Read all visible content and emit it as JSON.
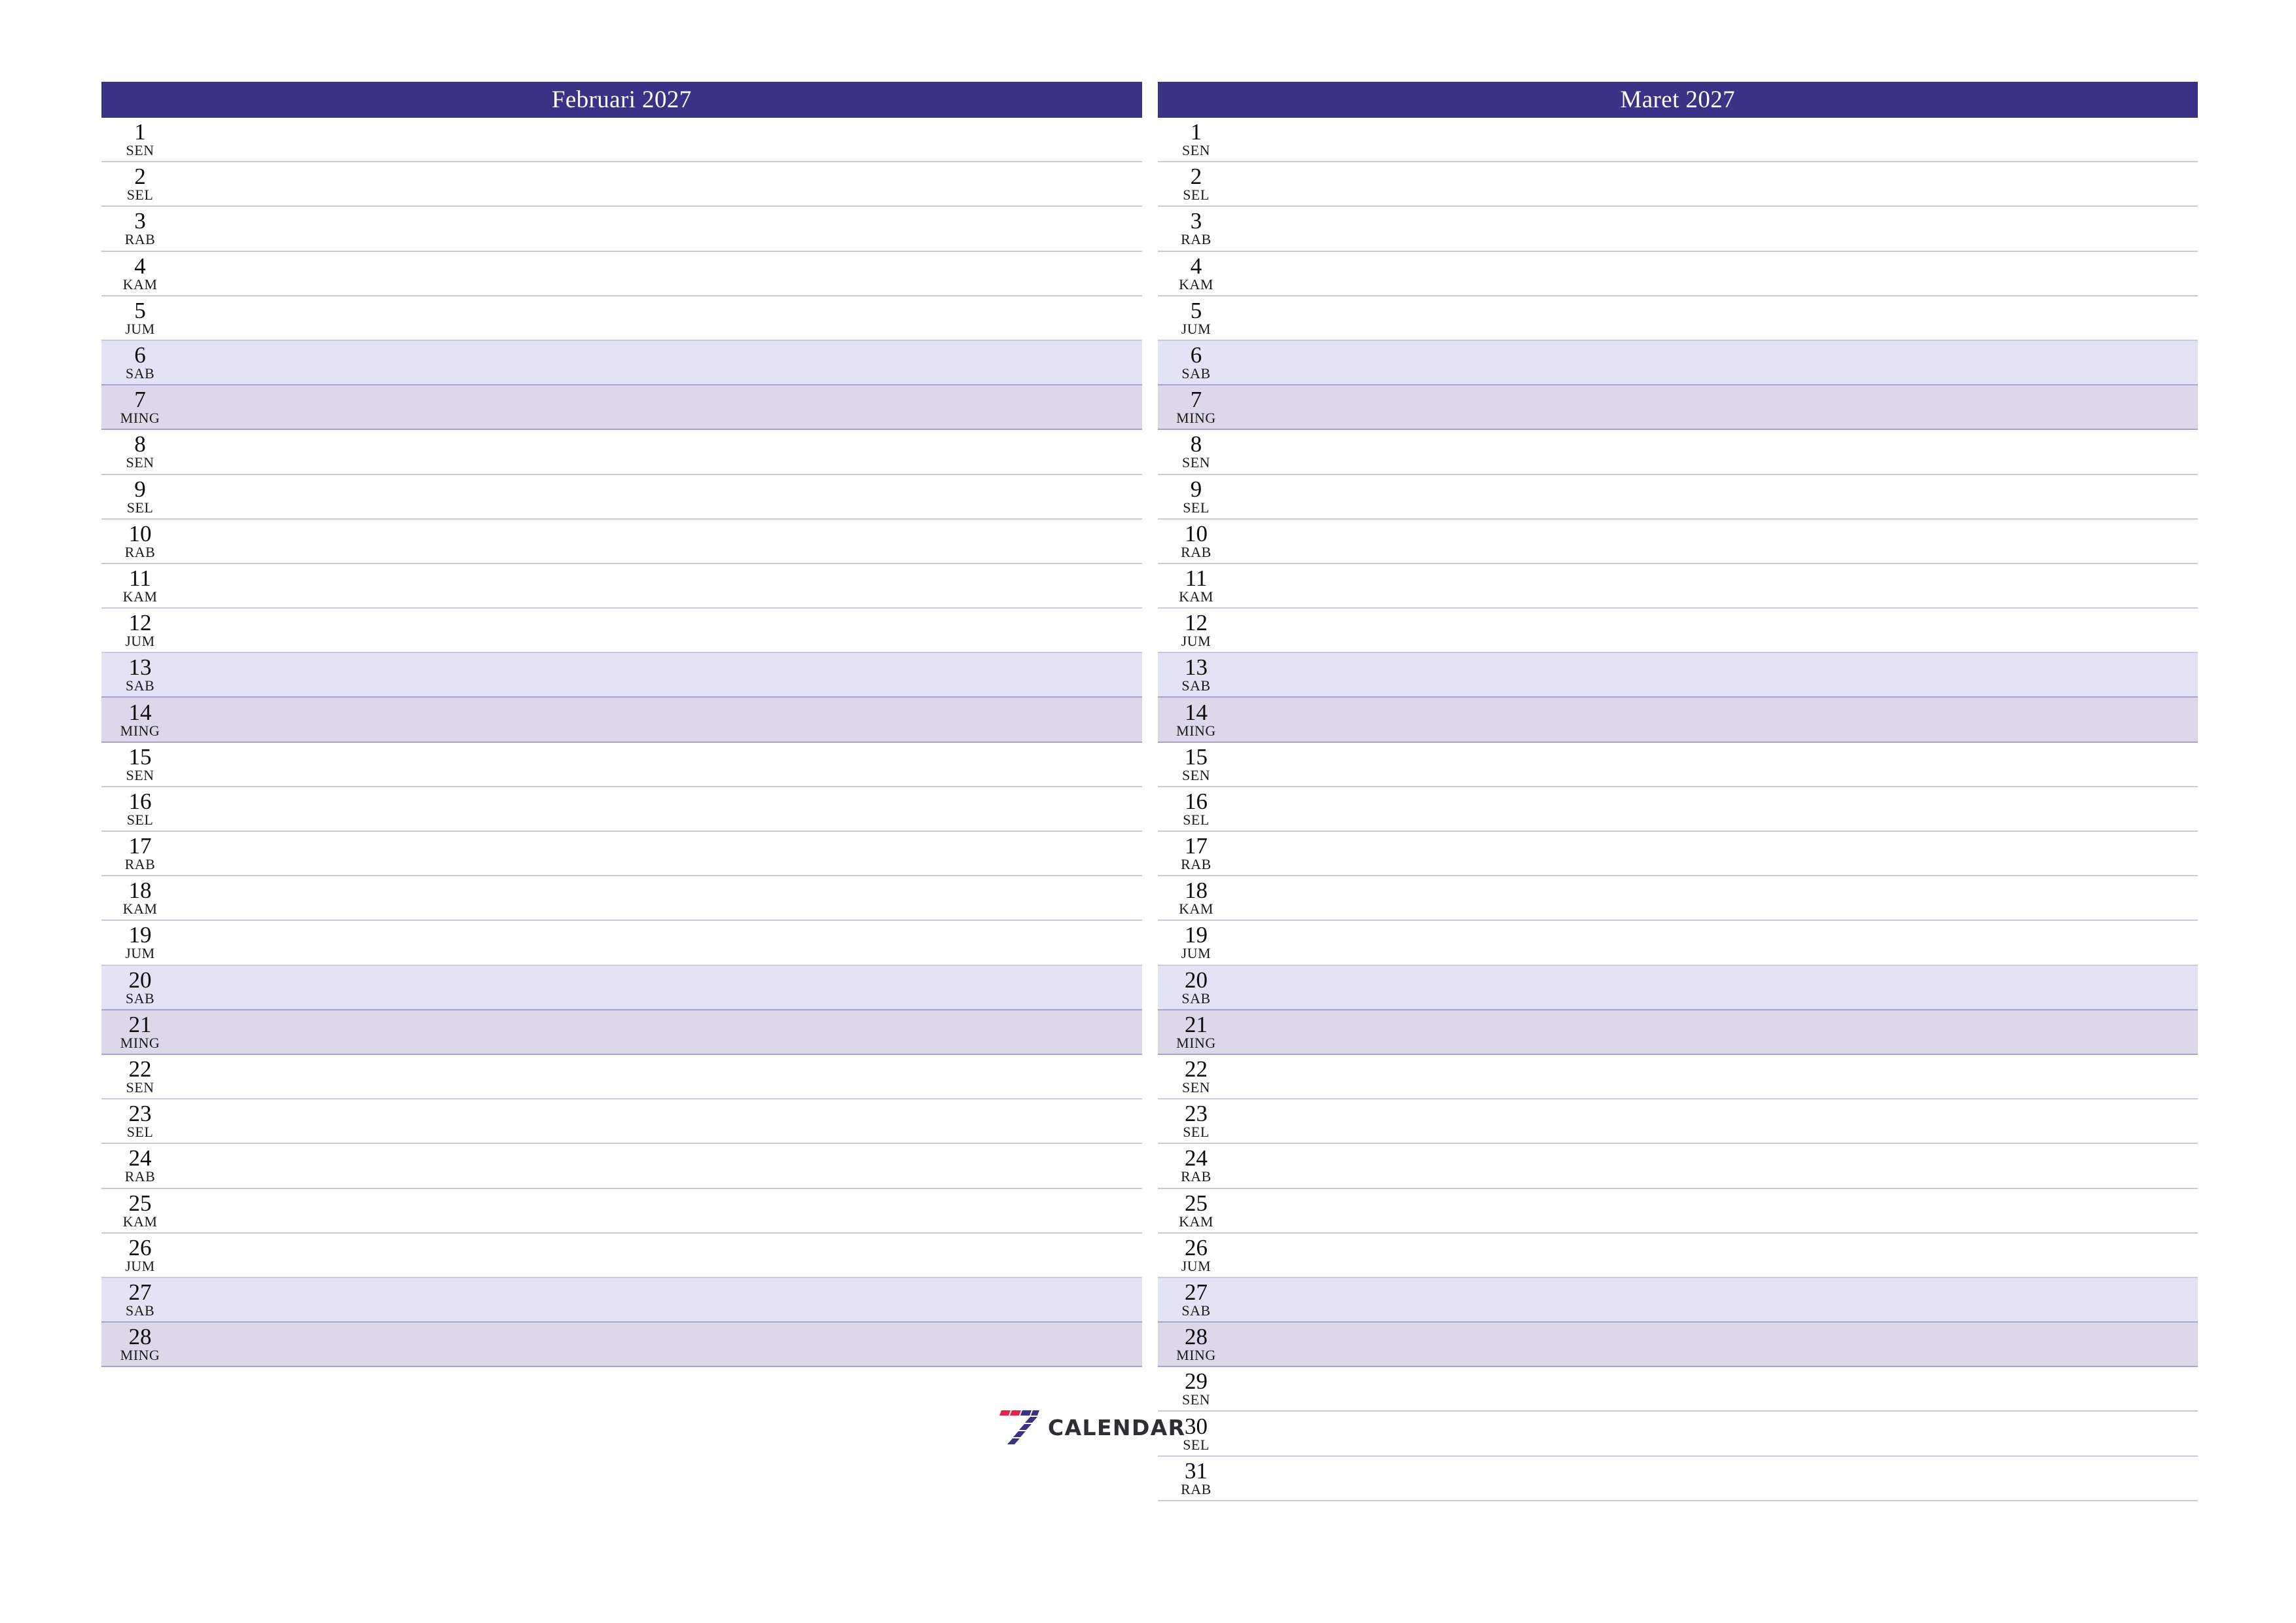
{
  "document": {
    "type": "two-month-planner",
    "language": "id",
    "orientation": "landscape"
  },
  "colors": {
    "header_bg": "#3a3287",
    "header_text": "#ffffff",
    "saturday_bg": "#e3e3f6",
    "sunday_bg": "#dcd8ea",
    "row_divider": "#c9c9e0",
    "weekend_divider": "#a9a3cb",
    "page_bg": "#ffffff",
    "day_text": "#0d0d0d",
    "logo_red": "#e8234a",
    "logo_indigo": "#3a3287",
    "logo_wordmark": "#2e2e33"
  },
  "brand": {
    "mark_name": "seven-calendar-logo",
    "wordmark": "CALENDAR"
  },
  "months": [
    {
      "id": "februari-2027",
      "title": "Februari 2027",
      "days": [
        {
          "num": "1",
          "abbr": "SEN",
          "type": "weekday"
        },
        {
          "num": "2",
          "abbr": "SEL",
          "type": "weekday"
        },
        {
          "num": "3",
          "abbr": "RAB",
          "type": "weekday"
        },
        {
          "num": "4",
          "abbr": "KAM",
          "type": "weekday"
        },
        {
          "num": "5",
          "abbr": "JUM",
          "type": "weekday"
        },
        {
          "num": "6",
          "abbr": "SAB",
          "type": "saturday"
        },
        {
          "num": "7",
          "abbr": "MING",
          "type": "sunday"
        },
        {
          "num": "8",
          "abbr": "SEN",
          "type": "weekday"
        },
        {
          "num": "9",
          "abbr": "SEL",
          "type": "weekday"
        },
        {
          "num": "10",
          "abbr": "RAB",
          "type": "weekday"
        },
        {
          "num": "11",
          "abbr": "KAM",
          "type": "weekday"
        },
        {
          "num": "12",
          "abbr": "JUM",
          "type": "weekday"
        },
        {
          "num": "13",
          "abbr": "SAB",
          "type": "saturday"
        },
        {
          "num": "14",
          "abbr": "MING",
          "type": "sunday"
        },
        {
          "num": "15",
          "abbr": "SEN",
          "type": "weekday"
        },
        {
          "num": "16",
          "abbr": "SEL",
          "type": "weekday"
        },
        {
          "num": "17",
          "abbr": "RAB",
          "type": "weekday"
        },
        {
          "num": "18",
          "abbr": "KAM",
          "type": "weekday"
        },
        {
          "num": "19",
          "abbr": "JUM",
          "type": "weekday"
        },
        {
          "num": "20",
          "abbr": "SAB",
          "type": "saturday"
        },
        {
          "num": "21",
          "abbr": "MING",
          "type": "sunday"
        },
        {
          "num": "22",
          "abbr": "SEN",
          "type": "weekday"
        },
        {
          "num": "23",
          "abbr": "SEL",
          "type": "weekday"
        },
        {
          "num": "24",
          "abbr": "RAB",
          "type": "weekday"
        },
        {
          "num": "25",
          "abbr": "KAM",
          "type": "weekday"
        },
        {
          "num": "26",
          "abbr": "JUM",
          "type": "weekday"
        },
        {
          "num": "27",
          "abbr": "SAB",
          "type": "saturday"
        },
        {
          "num": "28",
          "abbr": "MING",
          "type": "sunday"
        }
      ]
    },
    {
      "id": "maret-2027",
      "title": "Maret 2027",
      "days": [
        {
          "num": "1",
          "abbr": "SEN",
          "type": "weekday"
        },
        {
          "num": "2",
          "abbr": "SEL",
          "type": "weekday"
        },
        {
          "num": "3",
          "abbr": "RAB",
          "type": "weekday"
        },
        {
          "num": "4",
          "abbr": "KAM",
          "type": "weekday"
        },
        {
          "num": "5",
          "abbr": "JUM",
          "type": "weekday"
        },
        {
          "num": "6",
          "abbr": "SAB",
          "type": "saturday"
        },
        {
          "num": "7",
          "abbr": "MING",
          "type": "sunday"
        },
        {
          "num": "8",
          "abbr": "SEN",
          "type": "weekday"
        },
        {
          "num": "9",
          "abbr": "SEL",
          "type": "weekday"
        },
        {
          "num": "10",
          "abbr": "RAB",
          "type": "weekday"
        },
        {
          "num": "11",
          "abbr": "KAM",
          "type": "weekday"
        },
        {
          "num": "12",
          "abbr": "JUM",
          "type": "weekday"
        },
        {
          "num": "13",
          "abbr": "SAB",
          "type": "saturday"
        },
        {
          "num": "14",
          "abbr": "MING",
          "type": "sunday"
        },
        {
          "num": "15",
          "abbr": "SEN",
          "type": "weekday"
        },
        {
          "num": "16",
          "abbr": "SEL",
          "type": "weekday"
        },
        {
          "num": "17",
          "abbr": "RAB",
          "type": "weekday"
        },
        {
          "num": "18",
          "abbr": "KAM",
          "type": "weekday"
        },
        {
          "num": "19",
          "abbr": "JUM",
          "type": "weekday"
        },
        {
          "num": "20",
          "abbr": "SAB",
          "type": "saturday"
        },
        {
          "num": "21",
          "abbr": "MING",
          "type": "sunday"
        },
        {
          "num": "22",
          "abbr": "SEN",
          "type": "weekday"
        },
        {
          "num": "23",
          "abbr": "SEL",
          "type": "weekday"
        },
        {
          "num": "24",
          "abbr": "RAB",
          "type": "weekday"
        },
        {
          "num": "25",
          "abbr": "KAM",
          "type": "weekday"
        },
        {
          "num": "26",
          "abbr": "JUM",
          "type": "weekday"
        },
        {
          "num": "27",
          "abbr": "SAB",
          "type": "saturday"
        },
        {
          "num": "28",
          "abbr": "MING",
          "type": "sunday"
        },
        {
          "num": "29",
          "abbr": "SEN",
          "type": "weekday"
        },
        {
          "num": "30",
          "abbr": "SEL",
          "type": "weekday"
        },
        {
          "num": "31",
          "abbr": "RAB",
          "type": "weekday"
        }
      ]
    }
  ]
}
